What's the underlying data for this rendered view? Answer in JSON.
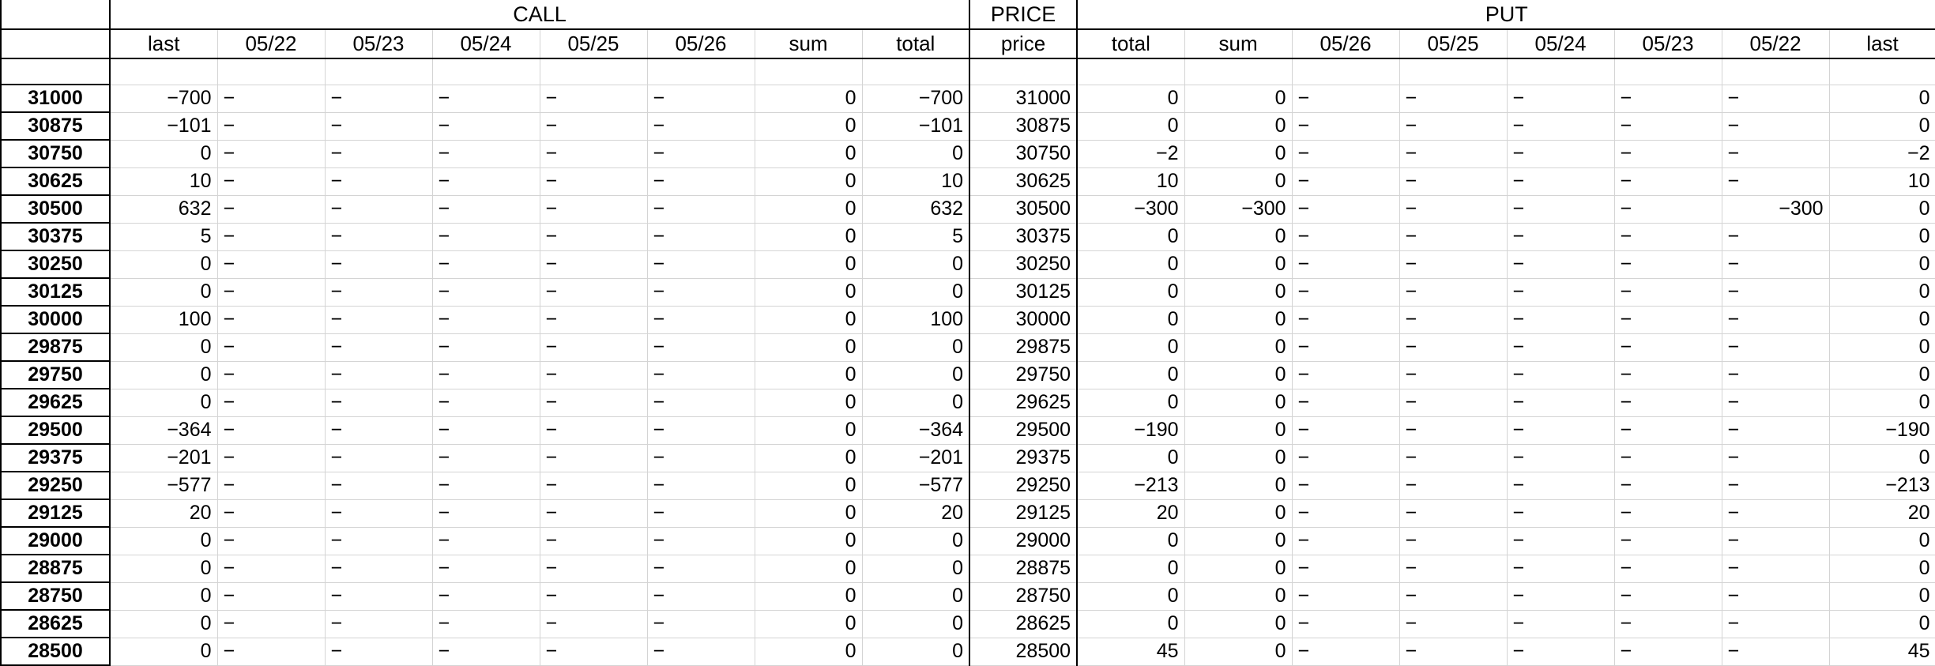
{
  "groups": {
    "call": "CALL",
    "price": "PRICE",
    "put": "PUT"
  },
  "headers": {
    "call": [
      "last",
      "05/22",
      "05/23",
      "05/24",
      "05/25",
      "05/26",
      "sum",
      "total"
    ],
    "price": "price",
    "put": [
      "total",
      "sum",
      "05/26",
      "05/25",
      "05/24",
      "05/23",
      "05/22",
      "last"
    ]
  },
  "rows": [
    {
      "label": "31000",
      "call": [
        "−700",
        "−",
        "−",
        "−",
        "−",
        "−",
        "0",
        "−700"
      ],
      "price": "31000",
      "put": [
        "0",
        "0",
        "−",
        "−",
        "−",
        "−",
        "−",
        "0"
      ]
    },
    {
      "label": "30875",
      "call": [
        "−101",
        "−",
        "−",
        "−",
        "−",
        "−",
        "0",
        "−101"
      ],
      "price": "30875",
      "put": [
        "0",
        "0",
        "−",
        "−",
        "−",
        "−",
        "−",
        "0"
      ]
    },
    {
      "label": "30750",
      "call": [
        "0",
        "−",
        "−",
        "−",
        "−",
        "−",
        "0",
        "0"
      ],
      "price": "30750",
      "put": [
        "−2",
        "0",
        "−",
        "−",
        "−",
        "−",
        "−",
        "−2"
      ]
    },
    {
      "label": "30625",
      "call": [
        "10",
        "−",
        "−",
        "−",
        "−",
        "−",
        "0",
        "10"
      ],
      "price": "30625",
      "put": [
        "10",
        "0",
        "−",
        "−",
        "−",
        "−",
        "−",
        "10"
      ]
    },
    {
      "label": "30500",
      "call": [
        "632",
        "−",
        "−",
        "−",
        "−",
        "−",
        "0",
        "632"
      ],
      "price": "30500",
      "put": [
        "−300",
        "−300",
        "−",
        "−",
        "−",
        "−",
        "−300",
        "0"
      ]
    },
    {
      "label": "30375",
      "call": [
        "5",
        "−",
        "−",
        "−",
        "−",
        "−",
        "0",
        "5"
      ],
      "price": "30375",
      "put": [
        "0",
        "0",
        "−",
        "−",
        "−",
        "−",
        "−",
        "0"
      ]
    },
    {
      "label": "30250",
      "call": [
        "0",
        "−",
        "−",
        "−",
        "−",
        "−",
        "0",
        "0"
      ],
      "price": "30250",
      "put": [
        "0",
        "0",
        "−",
        "−",
        "−",
        "−",
        "−",
        "0"
      ]
    },
    {
      "label": "30125",
      "call": [
        "0",
        "−",
        "−",
        "−",
        "−",
        "−",
        "0",
        "0"
      ],
      "price": "30125",
      "put": [
        "0",
        "0",
        "−",
        "−",
        "−",
        "−",
        "−",
        "0"
      ]
    },
    {
      "label": "30000",
      "call": [
        "100",
        "−",
        "−",
        "−",
        "−",
        "−",
        "0",
        "100"
      ],
      "price": "30000",
      "put": [
        "0",
        "0",
        "−",
        "−",
        "−",
        "−",
        "−",
        "0"
      ]
    },
    {
      "label": "29875",
      "call": [
        "0",
        "−",
        "−",
        "−",
        "−",
        "−",
        "0",
        "0"
      ],
      "price": "29875",
      "put": [
        "0",
        "0",
        "−",
        "−",
        "−",
        "−",
        "−",
        "0"
      ]
    },
    {
      "label": "29750",
      "call": [
        "0",
        "−",
        "−",
        "−",
        "−",
        "−",
        "0",
        "0"
      ],
      "price": "29750",
      "put": [
        "0",
        "0",
        "−",
        "−",
        "−",
        "−",
        "−",
        "0"
      ]
    },
    {
      "label": "29625",
      "call": [
        "0",
        "−",
        "−",
        "−",
        "−",
        "−",
        "0",
        "0"
      ],
      "price": "29625",
      "put": [
        "0",
        "0",
        "−",
        "−",
        "−",
        "−",
        "−",
        "0"
      ]
    },
    {
      "label": "29500",
      "call": [
        "−364",
        "−",
        "−",
        "−",
        "−",
        "−",
        "0",
        "−364"
      ],
      "price": "29500",
      "put": [
        "−190",
        "0",
        "−",
        "−",
        "−",
        "−",
        "−",
        "−190"
      ]
    },
    {
      "label": "29375",
      "call": [
        "−201",
        "−",
        "−",
        "−",
        "−",
        "−",
        "0",
        "−201"
      ],
      "price": "29375",
      "put": [
        "0",
        "0",
        "−",
        "−",
        "−",
        "−",
        "−",
        "0"
      ]
    },
    {
      "label": "29250",
      "call": [
        "−577",
        "−",
        "−",
        "−",
        "−",
        "−",
        "0",
        "−577"
      ],
      "price": "29250",
      "put": [
        "−213",
        "0",
        "−",
        "−",
        "−",
        "−",
        "−",
        "−213"
      ]
    },
    {
      "label": "29125",
      "call": [
        "20",
        "−",
        "−",
        "−",
        "−",
        "−",
        "0",
        "20"
      ],
      "price": "29125",
      "put": [
        "20",
        "0",
        "−",
        "−",
        "−",
        "−",
        "−",
        "20"
      ]
    },
    {
      "label": "29000",
      "call": [
        "0",
        "−",
        "−",
        "−",
        "−",
        "−",
        "0",
        "0"
      ],
      "price": "29000",
      "put": [
        "0",
        "0",
        "−",
        "−",
        "−",
        "−",
        "−",
        "0"
      ]
    },
    {
      "label": "28875",
      "call": [
        "0",
        "−",
        "−",
        "−",
        "−",
        "−",
        "0",
        "0"
      ],
      "price": "28875",
      "put": [
        "0",
        "0",
        "−",
        "−",
        "−",
        "−",
        "−",
        "0"
      ]
    },
    {
      "label": "28750",
      "call": [
        "0",
        "−",
        "−",
        "−",
        "−",
        "−",
        "0",
        "0"
      ],
      "price": "28750",
      "put": [
        "0",
        "0",
        "−",
        "−",
        "−",
        "−",
        "−",
        "0"
      ]
    },
    {
      "label": "28625",
      "call": [
        "0",
        "−",
        "−",
        "−",
        "−",
        "−",
        "0",
        "0"
      ],
      "price": "28625",
      "put": [
        "0",
        "0",
        "−",
        "−",
        "−",
        "−",
        "−",
        "0"
      ]
    },
    {
      "label": "28500",
      "call": [
        "0",
        "−",
        "−",
        "−",
        "−",
        "−",
        "0",
        "0"
      ],
      "price": "28500",
      "put": [
        "45",
        "0",
        "−",
        "−",
        "−",
        "−",
        "−",
        "45"
      ]
    }
  ]
}
